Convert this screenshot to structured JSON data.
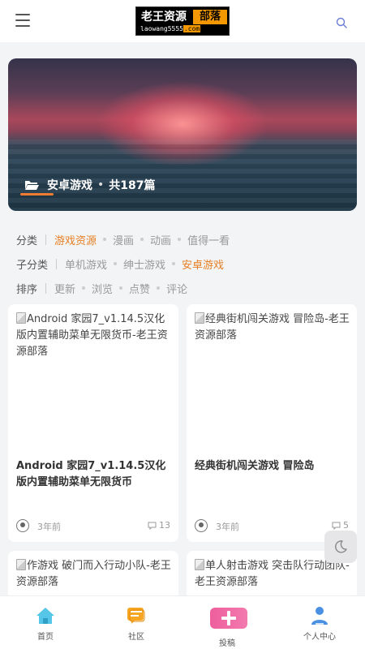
{
  "header": {
    "logo_main": "老王资源",
    "logo_tag": "部落",
    "logo_sub_a": "laowang5555",
    "logo_sub_b": ".com",
    "icons": {
      "menu": "menu-icon",
      "search": "search-icon"
    }
  },
  "banner": {
    "category": "安卓游戏",
    "count": "共187篇",
    "icon": "folder-icon",
    "accent": "#f07c33"
  },
  "filters": {
    "category": {
      "label": "分类",
      "options": [
        "游戏资源",
        "漫画",
        "动画",
        "值得一看"
      ],
      "active": "游戏资源"
    },
    "subcategory": {
      "label": "子分类",
      "options": [
        "单机游戏",
        "绅士游戏",
        "安卓游戏"
      ],
      "active": "安卓游戏"
    },
    "sort": {
      "label": "排序",
      "options": [
        "更新",
        "浏览",
        "点赞",
        "评论"
      ]
    },
    "active_color": "#e67e22"
  },
  "posts": [
    {
      "image_alt": "Android 家园7_v1.14.5汉化版内置辅助菜单无限货币-老王资源部落",
      "title": "Android 家园7_v1.14.5汉化版内置辅助菜单无限货币",
      "time": "3年前",
      "comments": "13"
    },
    {
      "image_alt": "经典街机闯关游戏 冒险岛-老王资源部落",
      "title": "经典街机闯关游戏 冒险岛",
      "time": "3年前",
      "comments": "5"
    },
    {
      "image_alt": "作游戏 破门而入行动小队-老王资源部落"
    },
    {
      "image_alt": "单人射击游戏 突击队行动团队-老王资源部落"
    }
  ],
  "bottom_nav": [
    {
      "label": "首页",
      "icon": "home-icon"
    },
    {
      "label": "社区",
      "icon": "community-icon"
    },
    {
      "label": "投稿",
      "icon": "plus-icon"
    },
    {
      "label": "个人中心",
      "icon": "user-icon"
    }
  ],
  "dark_mode_icon": "moon-icon"
}
